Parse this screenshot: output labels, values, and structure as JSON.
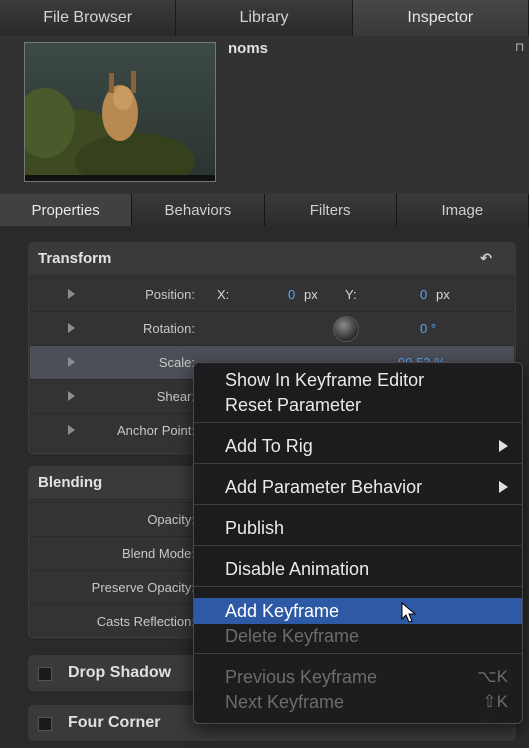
{
  "top_tabs": [
    "File Browser",
    "Library",
    "Inspector"
  ],
  "preview": {
    "title": "noms"
  },
  "sub_tabs": [
    "Properties",
    "Behaviors",
    "Filters",
    "Image"
  ],
  "transform": {
    "header": "Transform",
    "position": {
      "label": "Position:",
      "x_label": "X:",
      "x_value": "0",
      "x_unit": "px",
      "y_label": "Y:",
      "y_value": "0",
      "y_unit": "px"
    },
    "rotation": {
      "label": "Rotation:",
      "value": "0 °"
    },
    "scale": {
      "label": "Scale:",
      "value": "99.53 %"
    },
    "shear": {
      "label": "Shear:"
    },
    "anchor": {
      "label": "Anchor Point:"
    }
  },
  "blending": {
    "header": "Blending",
    "opacity": "Opacity:",
    "blend_mode": "Blend Mode:",
    "preserve_opacity": "Preserve Opacity:",
    "casts_reflection": "Casts Reflection:"
  },
  "groups": {
    "drop_shadow": "Drop Shadow",
    "four_corner": "Four Corner"
  },
  "context_menu": {
    "show_keyframe_editor": "Show In Keyframe Editor",
    "reset_parameter": "Reset Parameter",
    "add_to_rig": "Add To Rig",
    "add_parameter_behavior": "Add Parameter Behavior",
    "publish": "Publish",
    "disable_animation": "Disable Animation",
    "add_keyframe": "Add Keyframe",
    "delete_keyframe": "Delete Keyframe",
    "previous_keyframe": "Previous Keyframe",
    "previous_shortcut": "⌥K",
    "next_keyframe": "Next Keyframe",
    "next_shortcut": "⇧K"
  },
  "colors": {
    "accent": "#5aa7ff",
    "highlight": "#2e5aa5"
  }
}
